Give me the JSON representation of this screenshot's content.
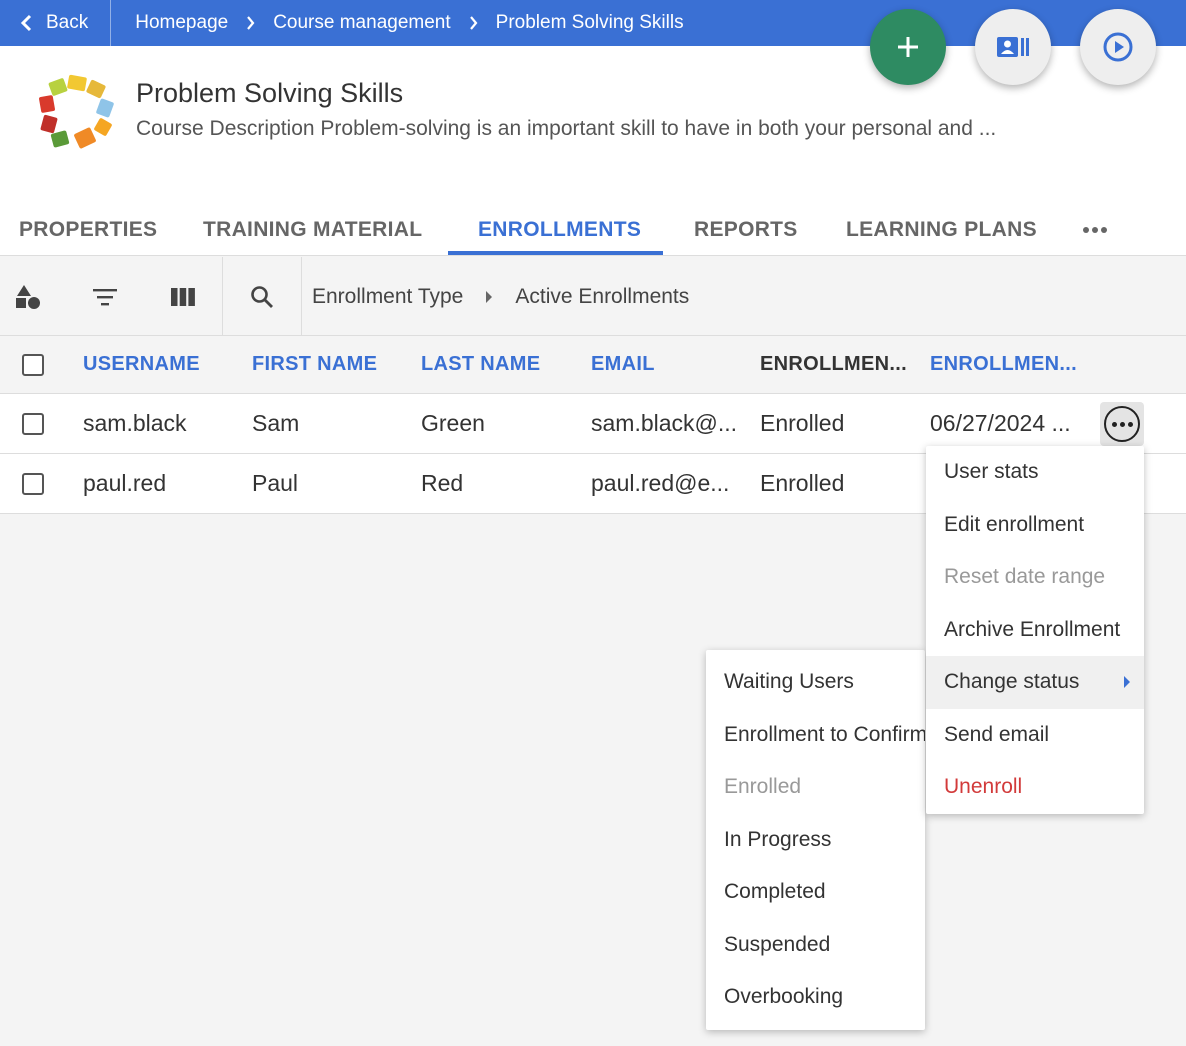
{
  "topbar": {
    "back_label": "Back",
    "breadcrumb": [
      "Homepage",
      "Course management",
      "Problem Solving Skills"
    ]
  },
  "course": {
    "title": "Problem Solving Skills",
    "description": "Course Description Problem-solving is an important skill to have in both your personal and ..."
  },
  "fabs": {
    "add_icon": "plus-icon",
    "second_icon": "contact-card-icon",
    "third_icon": "play-circle-icon",
    "add_color": "#2e8b62"
  },
  "tabs": [
    {
      "label": "PROPERTIES",
      "active": false
    },
    {
      "label": "TRAINING MATERIAL",
      "active": false
    },
    {
      "label": "ENROLLMENTS",
      "active": true
    },
    {
      "label": "REPORTS",
      "active": false
    },
    {
      "label": "LEARNING PLANS",
      "active": false
    }
  ],
  "toolbar": {
    "icons": [
      "shapes-icon",
      "filter-icon",
      "columns-icon",
      "search-icon"
    ],
    "breadcrumb": [
      "Enrollment Type",
      "Active Enrollments"
    ]
  },
  "table": {
    "headers": [
      "USERNAME",
      "FIRST NAME",
      "LAST NAME",
      "EMAIL",
      "ENROLLMEN...",
      "ENROLLMEN..."
    ],
    "rows": [
      [
        "sam.black",
        "Sam",
        "Green",
        "sam.black@...",
        "Enrolled",
        "06/27/2024 ..."
      ],
      [
        "paul.red",
        "Paul",
        "Red",
        "paul.red@e...",
        "Enrolled",
        ""
      ]
    ]
  },
  "context_menu": {
    "items": [
      {
        "label": "User stats"
      },
      {
        "label": "Edit enrollment"
      },
      {
        "label": "Reset date range"
      },
      {
        "label": "Archive Enrollment"
      },
      {
        "label": "Change status"
      },
      {
        "label": "Send email"
      },
      {
        "label": "Unenroll"
      }
    ]
  },
  "status_submenu": {
    "items": [
      {
        "label": "Waiting Users"
      },
      {
        "label": "Enrollment to Confirm"
      },
      {
        "label": "Enrolled"
      },
      {
        "label": "In Progress"
      },
      {
        "label": "Completed"
      },
      {
        "label": "Suspended"
      },
      {
        "label": "Overbooking"
      }
    ]
  },
  "colors": {
    "primary": "#3a70d4",
    "danger": "#d23a3a",
    "success": "#2e8b62"
  }
}
